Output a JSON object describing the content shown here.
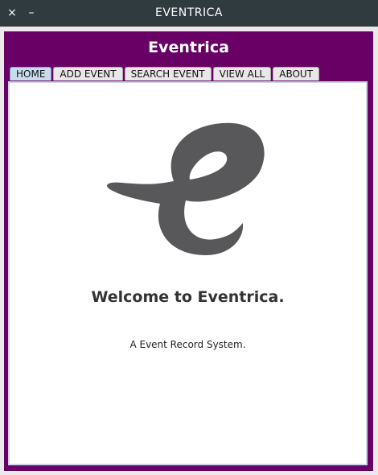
{
  "window": {
    "title": "EVENTRICA",
    "close_glyph": "×",
    "minimize_glyph": "–"
  },
  "app": {
    "title": "Eventrica",
    "accent_color": "#680066"
  },
  "tabs": [
    {
      "label": "HOME",
      "active": true
    },
    {
      "label": "ADD EVENT",
      "active": false
    },
    {
      "label": "SEARCH EVENT",
      "active": false
    },
    {
      "label": "VIEW ALL",
      "active": false
    },
    {
      "label": "ABOUT",
      "active": false
    }
  ],
  "home": {
    "logo_icon": "eventrica-e-logo",
    "logo_color": "#58585a",
    "welcome": "Welcome to Eventrica.",
    "tagline": "A Event Record System."
  }
}
